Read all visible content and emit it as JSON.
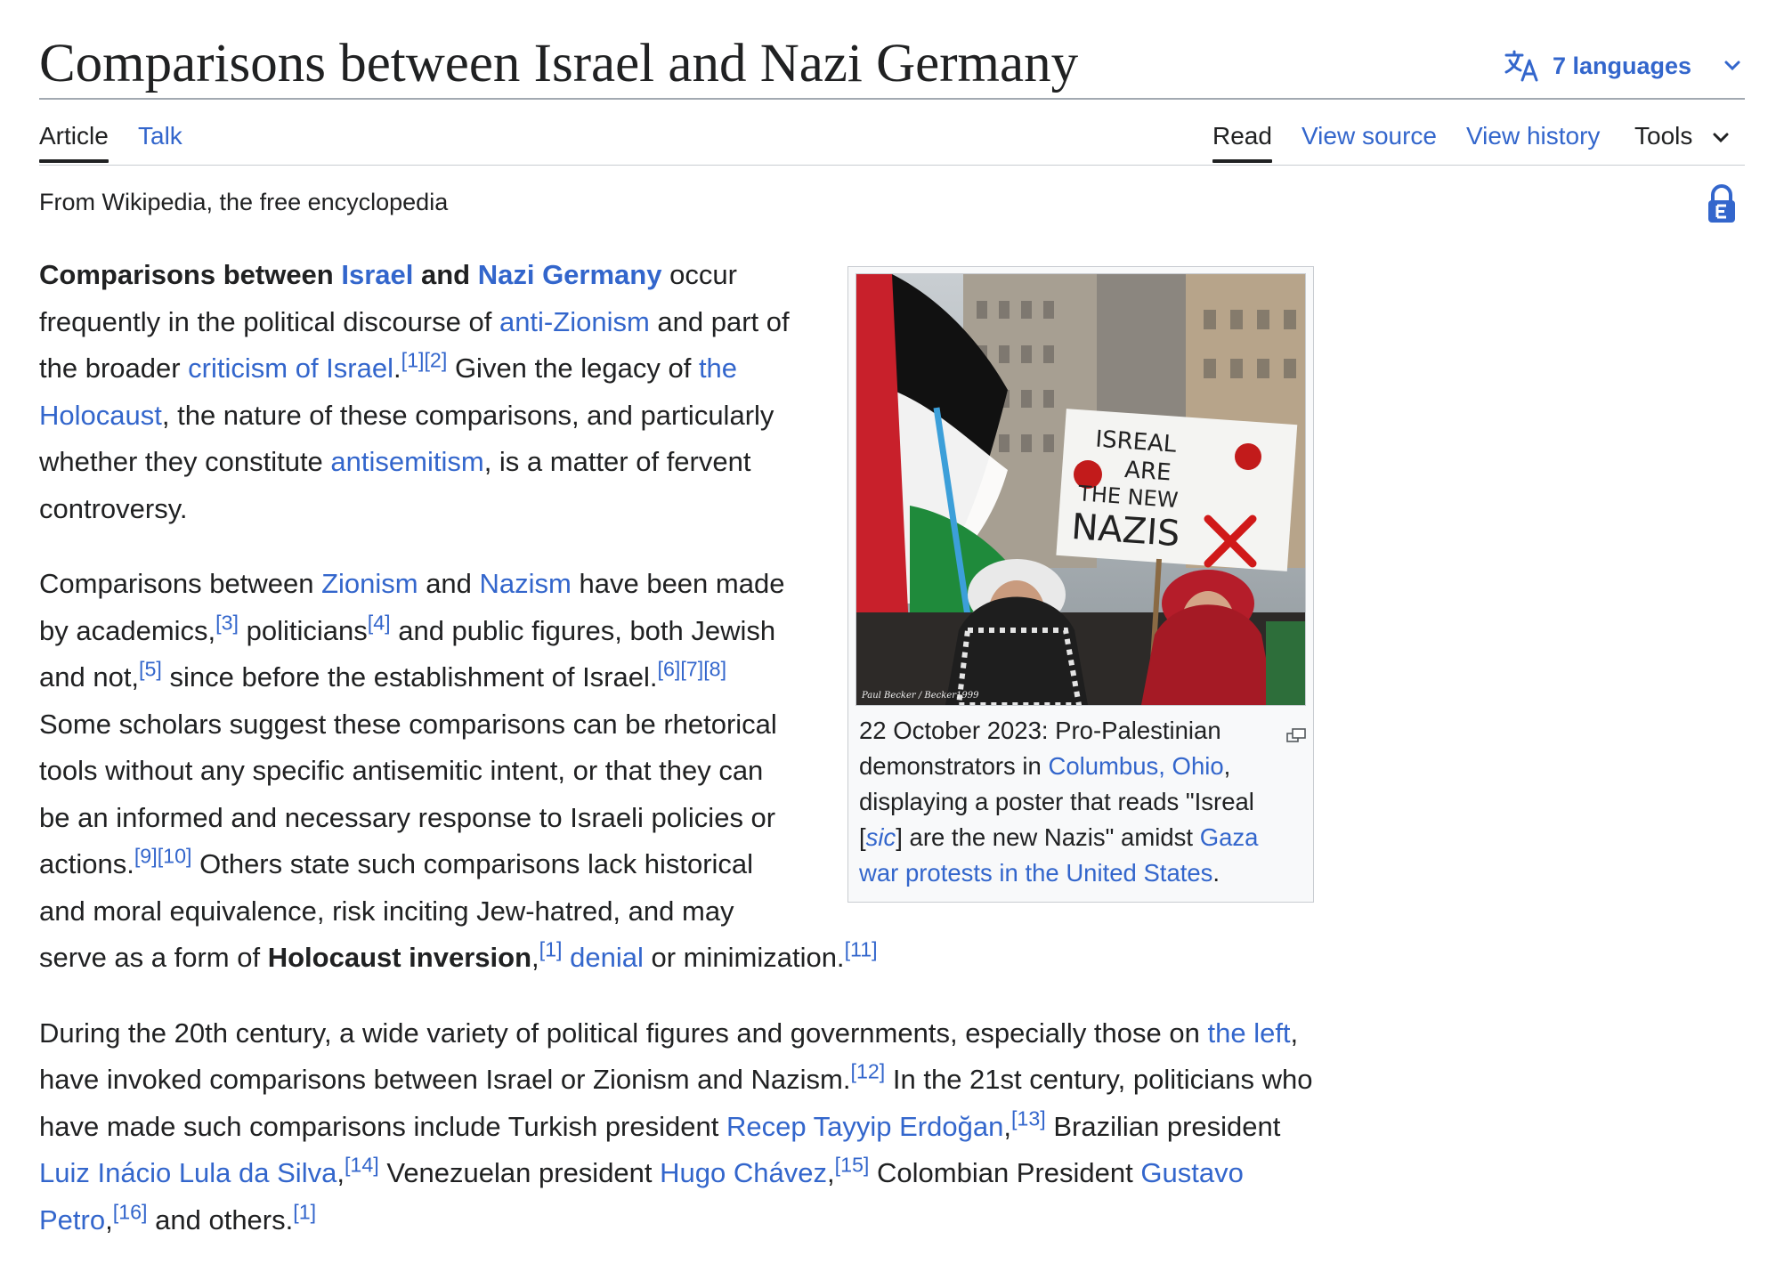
{
  "page": {
    "title": "Comparisons between Israel and Nazi Germany",
    "tagline": "From Wikipedia, the free encyclopedia"
  },
  "languages": {
    "label": "7 languages"
  },
  "tabs": {
    "article": "Article",
    "talk": "Talk",
    "read": "Read",
    "view_source": "View source",
    "view_history": "View history",
    "tools": "Tools"
  },
  "icons": {
    "language": "language-icon",
    "chevron": "chevron-down-icon",
    "protection": "lock-icon",
    "enlarge": "enlarge-icon"
  },
  "colors": {
    "link": "#3366cc",
    "text": "#202122",
    "border": "#a2a9b1"
  },
  "image": {
    "poster_lines": [
      "ISREAL",
      "ARE",
      "THE NEW",
      "NAZIS"
    ],
    "credit": "Paul Becker / Becker1999"
  },
  "caption": {
    "t1": "22 October 2023: Pro-Palestinian demonstrators in ",
    "l1": "Columbus, Ohio",
    "t2": ", displaying a poster that reads \"Isreal [",
    "sic": "sic",
    "t3": "] are the new Nazis\" amidst ",
    "l2": "Gaza war protests in the United States",
    "t4": "."
  },
  "p1": {
    "b1": "Comparisons between ",
    "l1": "Israel",
    "b2": " and ",
    "l2": "Nazi Germany",
    "t1": " occur frequently in the political discourse of ",
    "l3": "anti-Zionism",
    "t2": " and part of the broader ",
    "l4": "criticism of Israel",
    "t3": ".",
    "r1": "[1]",
    "r2": "[2]",
    "t4": " Given the legacy of ",
    "l5": "the Holocaust",
    "t5": ", the nature of these comparisons, and particularly whether they constitute ",
    "l6": "antisemitism",
    "t6": ", is a matter of fervent controversy."
  },
  "p2": {
    "t1": "Comparisons between ",
    "l1": "Zionism",
    "t2": " and ",
    "l2": "Nazism",
    "t3": " have been made by academics,",
    "r3": "[3]",
    "t4": " politicians",
    "r4": "[4]",
    "t5": " and public figures, both Jewish and not,",
    "r5": "[5]",
    "t6": " since before the establishment of Israel.",
    "r6": "[6]",
    "r7": "[7]",
    "r8": "[8]",
    "t7": " Some scholars suggest these comparisons can be rhetorical tools without any specific antisemitic intent, or that they can be an informed and necessary response to Israeli policies or actions.",
    "r9": "[9]",
    "r10": "[10]",
    "t8": " Others state such comparisons lack historical and moral equivalence, risk inciting Jew-hatred, and may serve as a form of ",
    "b1": "Holocaust inversion",
    "t9": ",",
    "r1": "[1]",
    "t10": " ",
    "l3": "denial",
    "t11": " or minimization.",
    "r11": "[11]"
  },
  "p3": {
    "t1": "During the 20th century, a wide variety of political figures and governments, especially those on ",
    "l1": "the left",
    "t2": ", have invoked comparisons between Israel or Zionism and Nazism.",
    "r12": "[12]",
    "t3": " In the 21st century, politicians who have made such comparisons include Turkish president ",
    "l2": "Recep Tayyip Erdoğan",
    "t4": ",",
    "r13": "[13]",
    "t5": " Brazilian president ",
    "l3": "Luiz Inácio Lula da Silva",
    "t6": ",",
    "r14": "[14]",
    "t7": " Venezuelan president ",
    "l4": "Hugo Chávez",
    "t8": ",",
    "r15": "[15]",
    "t9": " Colombian President ",
    "l5": "Gustavo Petro",
    "t10": ",",
    "r16": "[16]",
    "t11": " and others.",
    "r1": "[1]"
  }
}
